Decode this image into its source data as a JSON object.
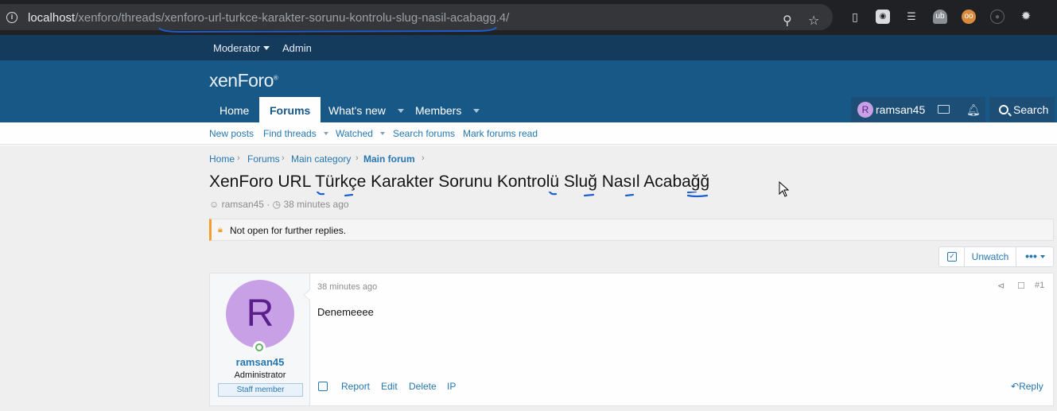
{
  "browser": {
    "url_host": "localhost",
    "url_path": "/xenforo/threads/xenforo-url-turkce-karakter-sorunu-kontrolu-slug-nasil-acabagg.4/"
  },
  "staff_bar": {
    "moderator": "Moderator",
    "admin": "Admin"
  },
  "header": {
    "logo": "xenForo",
    "tabs": [
      {
        "label": "Home"
      },
      {
        "label": "Forums"
      },
      {
        "label": "What's new"
      },
      {
        "label": "Members"
      }
    ],
    "username": "ramsan45",
    "avatar_letter": "R",
    "search_label": "Search"
  },
  "subnav": {
    "items": [
      {
        "label": "New posts"
      },
      {
        "label": "Find threads"
      },
      {
        "label": "Watched"
      },
      {
        "label": "Search forums"
      },
      {
        "label": "Mark forums read"
      }
    ]
  },
  "breadcrumb": [
    {
      "label": "Home"
    },
    {
      "label": "Forums"
    },
    {
      "label": "Main category"
    },
    {
      "label": "Main forum"
    }
  ],
  "thread": {
    "title": "XenForo URL Türkçe Karakter Sorunu Kontrolü Sluğ Nasıl Acabağğ",
    "author": "ramsan45",
    "time": "38 minutes ago",
    "notice": "Not open for further replies.",
    "unwatch_label": "Unwatch",
    "more_label": "•••"
  },
  "post": {
    "avatar_letter": "R",
    "username": "ramsan45",
    "user_title": "Administrator",
    "banner": "Staff member",
    "date": "38 minutes ago",
    "number": "#1",
    "body": "Denemeeee",
    "actions": [
      "Report",
      "Edit",
      "Delete",
      "IP"
    ],
    "reply_label": "Reply"
  },
  "colors": {
    "header_bg": "#185886",
    "staff_bar_bg": "#143b5c",
    "link": "#2577b1",
    "avatar_bg": "#c7a0e6",
    "annotation": "#1a5fd1"
  }
}
